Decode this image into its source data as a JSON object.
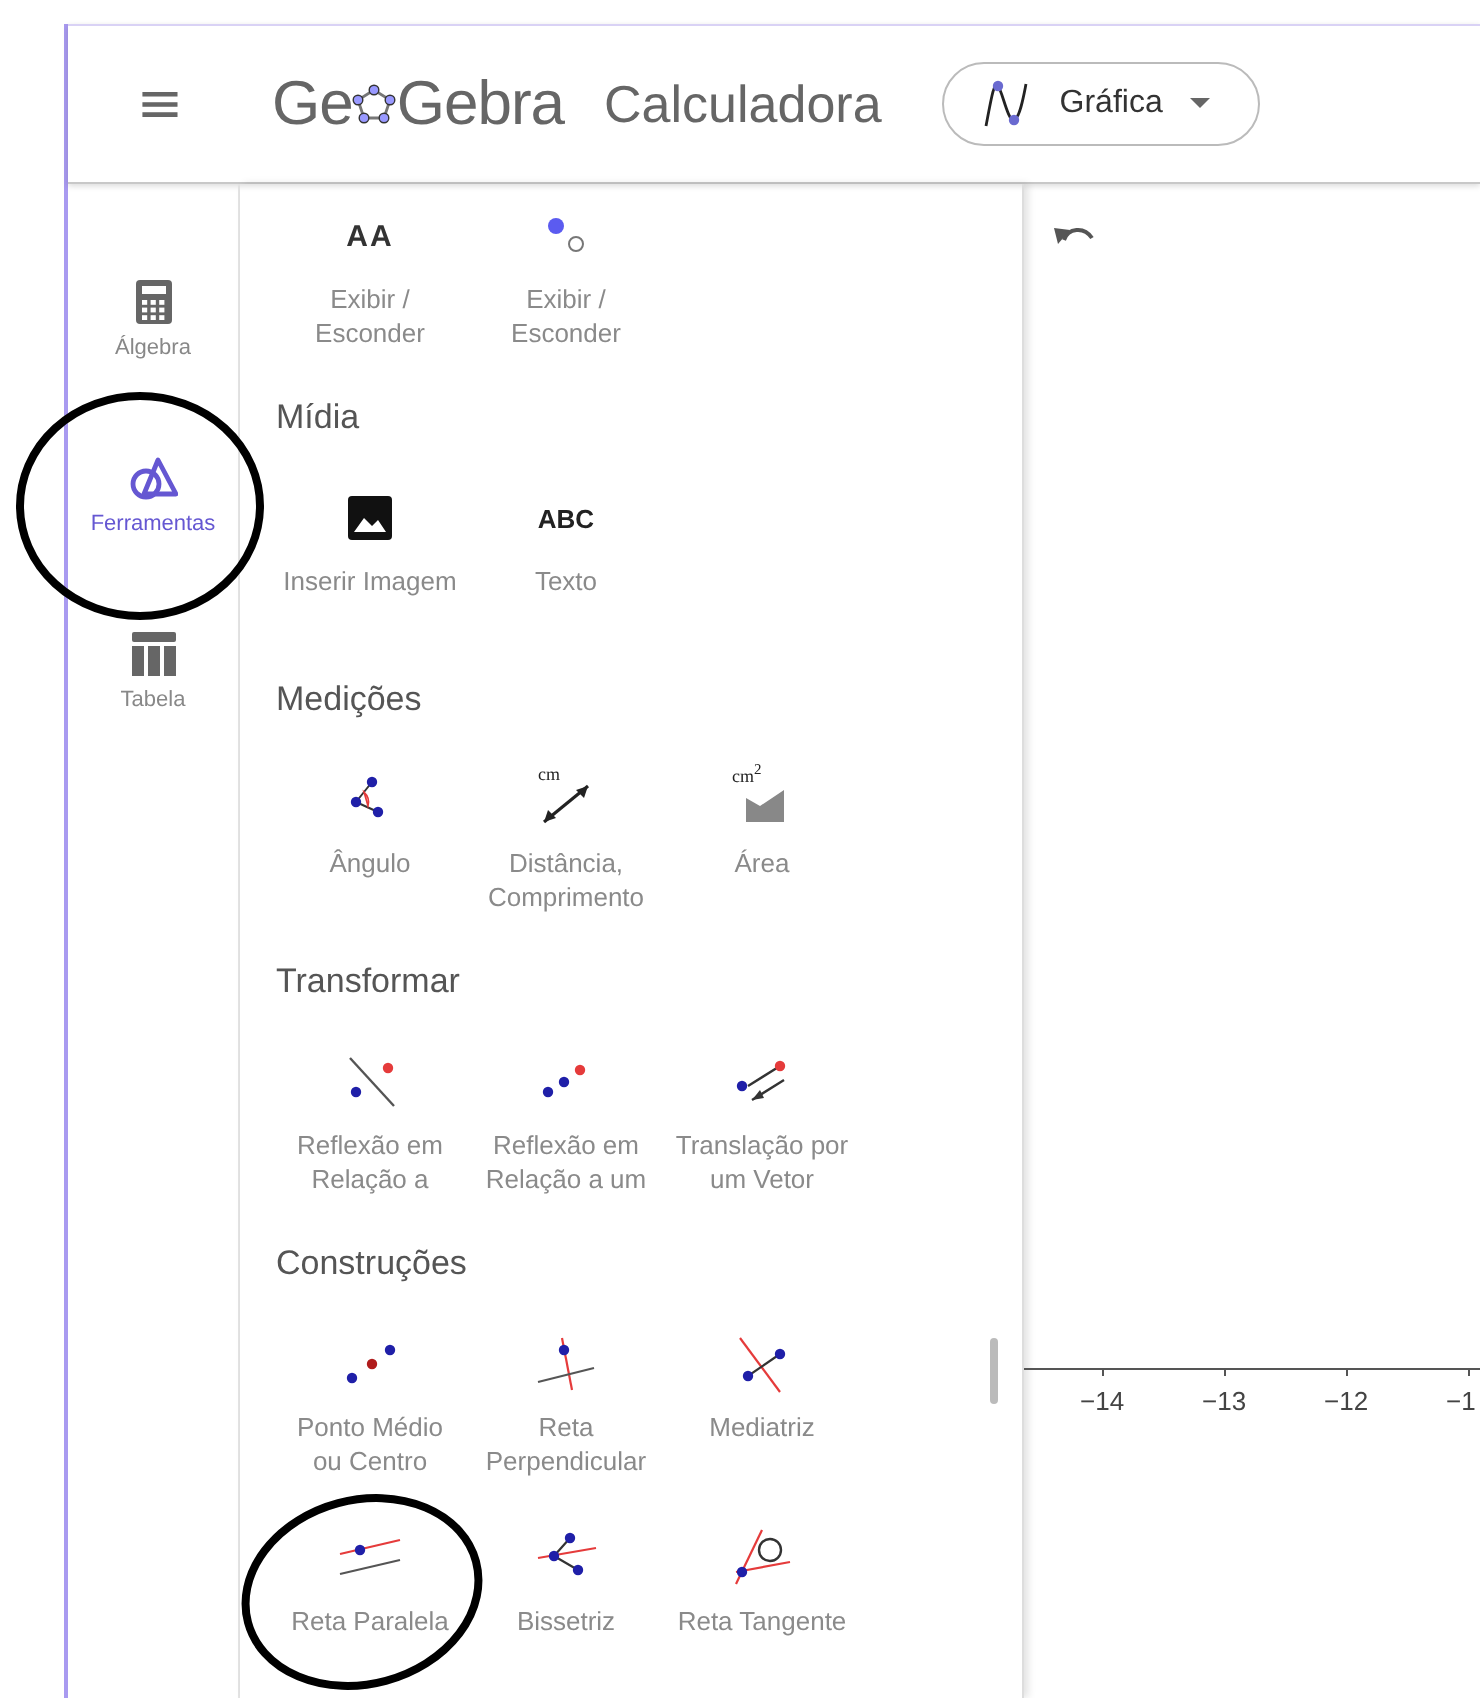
{
  "header": {
    "menu_icon": "≡",
    "logo_parts": [
      "Ge",
      "Gebra"
    ],
    "app_title": "Calculadora",
    "view_select": {
      "label": "Gráfica"
    }
  },
  "nav": [
    {
      "label": "Álgebra",
      "kind": "calculator",
      "selected": false
    },
    {
      "label": "Ferramentas",
      "kind": "tools",
      "selected": true
    },
    {
      "label": "Tabela",
      "kind": "table",
      "selected": false
    }
  ],
  "tool_sections": [
    {
      "tools": [
        {
          "label": "Exibir /\nEsconder",
          "kind": "text-style",
          "icon_text": "AA"
        },
        {
          "label": "Exibir /\nEsconder",
          "kind": "point-style"
        }
      ]
    },
    {
      "title": "Mídia",
      "tools": [
        {
          "label": "Inserir Imagem",
          "kind": "image"
        },
        {
          "label": "Texto",
          "kind": "text",
          "icon_text": "ABC"
        }
      ]
    },
    {
      "title": "Medições",
      "tools": [
        {
          "label": "Ângulo",
          "kind": "angle"
        },
        {
          "label": "Distância,\nComprimento",
          "kind": "distance",
          "icon_text": "cm"
        },
        {
          "label": "Área",
          "kind": "area",
          "icon_text": "cm$^{2}$"
        }
      ]
    },
    {
      "title": "Transformar",
      "tools": [
        {
          "label": "Reflexão em\nRelação a",
          "kind": "reflect-line"
        },
        {
          "label": "Reflexão em\nRelação a um",
          "kind": "reflect-point"
        },
        {
          "label": "Translação por\num Vetor",
          "kind": "translate"
        }
      ]
    },
    {
      "title": "Construções",
      "tools": [
        {
          "label": "Ponto Médio\nou Centro",
          "kind": "midpoint"
        },
        {
          "label": "Reta\nPerpendicular",
          "kind": "perpendicular"
        },
        {
          "label": "Mediatriz",
          "kind": "perp-bisector"
        },
        {
          "label": "Reta Paralela",
          "kind": "parallel"
        },
        {
          "label": "Bissetriz",
          "kind": "angle-bisector"
        },
        {
          "label": "Reta Tangente",
          "kind": "tangent"
        }
      ]
    }
  ],
  "graph": {
    "x_tick_labels": [
      "−14",
      "−13",
      "−12",
      "−1"
    ]
  }
}
